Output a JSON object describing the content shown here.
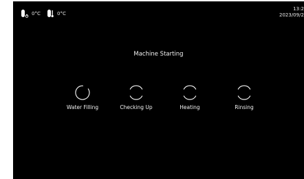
{
  "status_bar": {
    "sensor_1": {
      "icon": "thermometer-drop-icon",
      "value": "0°C"
    },
    "sensor_2": {
      "icon": "thermometer-icon",
      "value": "0°C"
    },
    "clock": {
      "time": "13:2",
      "date": "2023/09/2"
    }
  },
  "main": {
    "title": "Machine Starting",
    "steps": [
      {
        "label": "Water Filling",
        "icon": "spinner-icon",
        "active": true
      },
      {
        "label": "Checking Up",
        "icon": "pending-ring-icon",
        "active": false
      },
      {
        "label": "Heating",
        "icon": "pending-ring-icon",
        "active": false
      },
      {
        "label": "Rinsing",
        "icon": "pending-ring-icon",
        "active": false
      }
    ]
  },
  "colors": {
    "background": "#000000",
    "text": "#ffffff"
  }
}
